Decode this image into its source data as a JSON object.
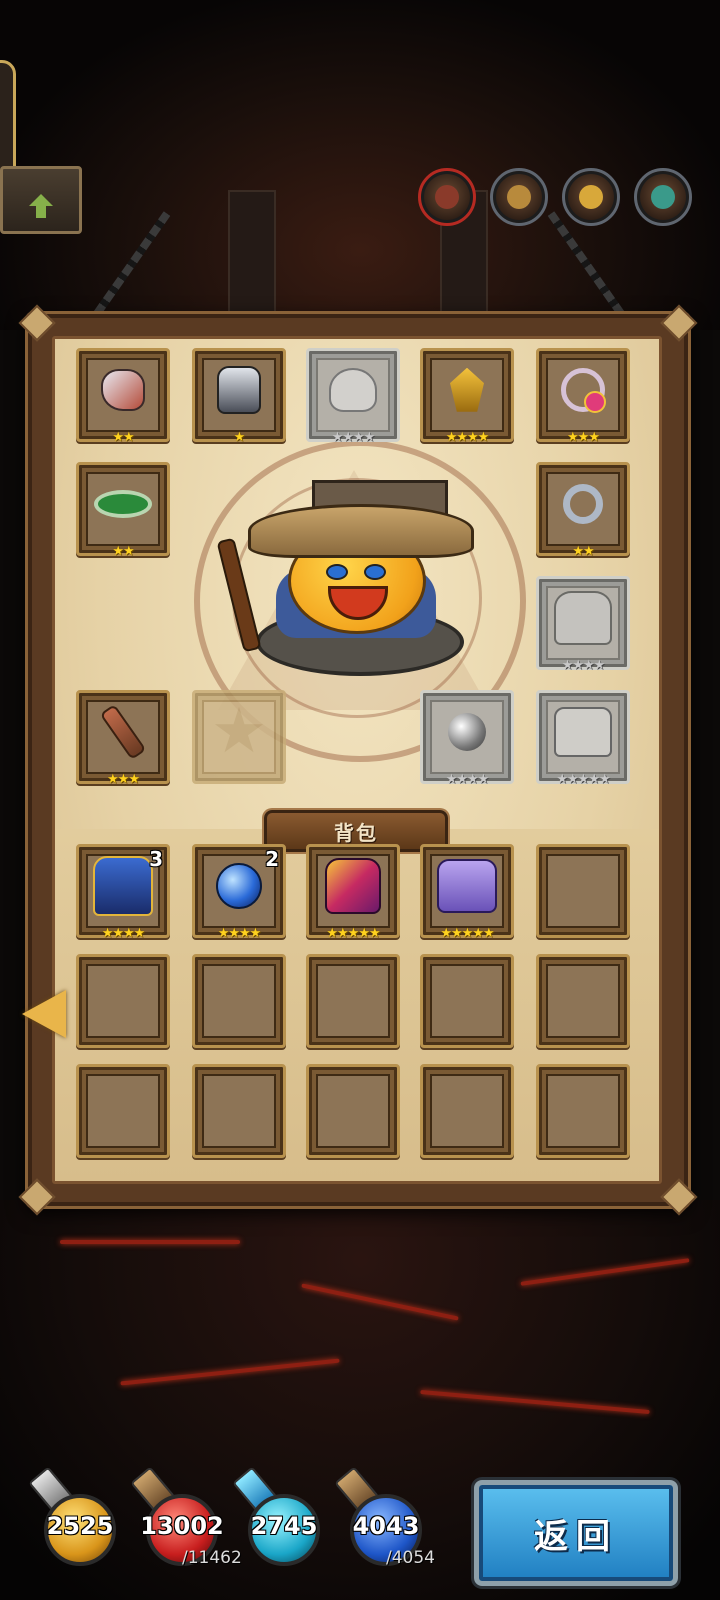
{
  "header": {
    "up_button": "arrow-up-icon",
    "portraits": [
      {
        "name": "hero-portrait-1",
        "active": true
      },
      {
        "name": "hero-portrait-2",
        "active": false
      },
      {
        "name": "hero-portrait-3",
        "active": false
      },
      {
        "name": "hero-portrait-4",
        "active": false
      }
    ]
  },
  "equipment": [
    {
      "slot": "gloves",
      "icon": "glove-icon",
      "stars": "★★"
    },
    {
      "slot": "armor",
      "icon": "armor-icon",
      "stars": "★"
    },
    {
      "slot": "helmet",
      "icon": "helmet-icon",
      "stars": "★★★★",
      "empty": true
    },
    {
      "slot": "lantern",
      "icon": "lantern-icon",
      "stars": "★★★★"
    },
    {
      "slot": "necklace",
      "icon": "necklace-icon",
      "stars": "★★★"
    },
    {
      "slot": "bracelet",
      "icon": "bracelet-icon",
      "stars": "★★"
    },
    {
      "slot": "ring",
      "icon": "ring-icon",
      "stars": "★★"
    },
    {
      "slot": "shoulder",
      "icon": "shoulder-armor-icon",
      "stars": "★★★★",
      "empty": true
    },
    {
      "slot": "weapon",
      "icon": "mace-icon",
      "stars": "★★★"
    },
    {
      "slot": "emblem",
      "icon": "emblem-icon",
      "stars": "",
      "empty": true
    },
    {
      "slot": "orb",
      "icon": "orb-icon",
      "stars": "★★★★",
      "empty": true
    },
    {
      "slot": "boots",
      "icon": "boots-icon",
      "stars": "★★★★★",
      "empty": true
    }
  ],
  "backpack": {
    "title": "背包",
    "items": [
      {
        "icon": "blue-cape-icon",
        "count": "3",
        "stars": "★★★★"
      },
      {
        "icon": "blue-orb-icon",
        "count": "2",
        "stars": "★★★★"
      },
      {
        "icon": "pink-boots-icon",
        "count": "",
        "stars": "★★★★★"
      },
      {
        "icon": "purple-boots-icon",
        "count": "",
        "stars": "★★★★★"
      }
    ]
  },
  "resources": [
    {
      "name": "gold",
      "value": "2525",
      "max": ""
    },
    {
      "name": "health-potion",
      "value": "13002",
      "max": "/11462"
    },
    {
      "name": "mana-crystal",
      "value": "2745",
      "max": ""
    },
    {
      "name": "mana-potion",
      "value": "4043",
      "max": "/4054"
    }
  ],
  "return_button": "返回",
  "colors": {
    "parchment": "#e6d2a6",
    "slot_border": "#b8924e",
    "star_gold": "#ffd21f",
    "return_blue": "#3a9fd8"
  }
}
